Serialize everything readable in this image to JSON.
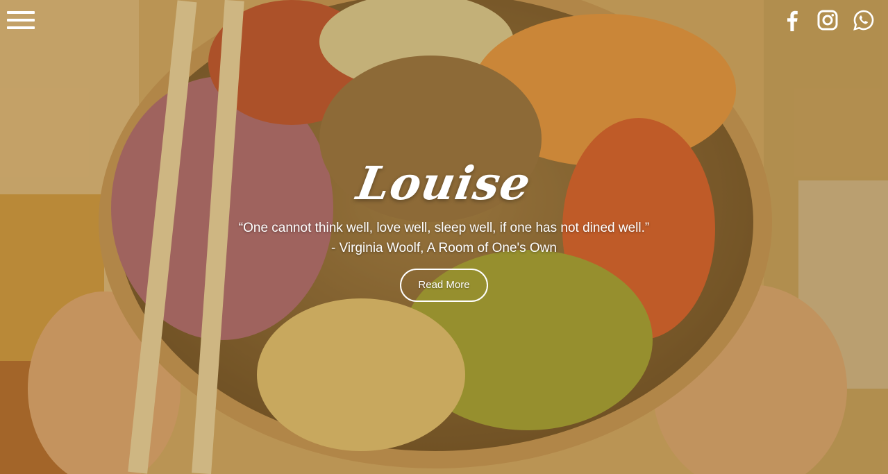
{
  "brand": {
    "name": "Louise"
  },
  "hero": {
    "quote_line1": "“One cannot think well, love well, sleep well, if one has not dined well.”",
    "quote_line2": "- Virginia Woolf, A Room of One's Own",
    "cta_label": "Read More"
  },
  "nav": {
    "menu_icon": "hamburger-menu-icon"
  },
  "social": [
    {
      "icon": "facebook-icon"
    },
    {
      "icon": "instagram-icon"
    },
    {
      "icon": "whatsapp-icon"
    }
  ],
  "colors": {
    "overlay": "#a88037",
    "text": "#ffffff"
  }
}
